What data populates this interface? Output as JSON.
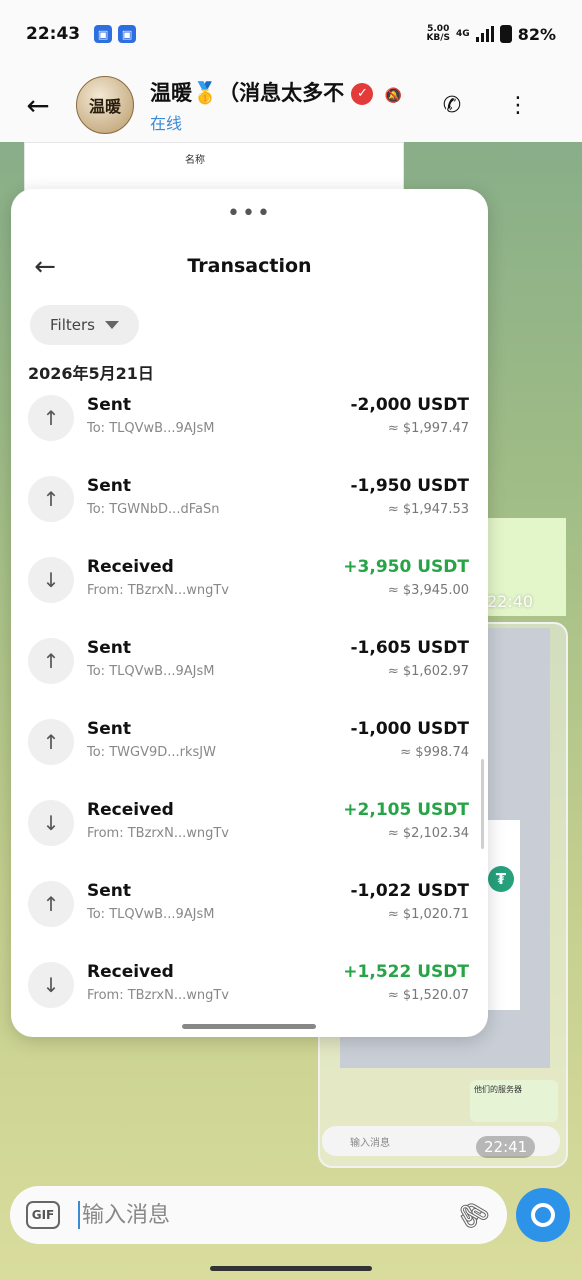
{
  "status_bar": {
    "time": "22:43",
    "net_speed_value": "5.00",
    "net_speed_unit": "KB/S",
    "network": "4G",
    "battery": "82%"
  },
  "chat_header": {
    "title": "温暖🥇（消息太多不",
    "subtitle": "在线",
    "avatar_text": "温暖"
  },
  "background": {
    "screenshot_header_cell": "名称",
    "bubble_time_1": "22:40",
    "inner_input_placeholder": "输入消息",
    "inner_time": "22:41",
    "inner_bubble_text": "他们的服务器"
  },
  "transaction_sheet": {
    "dots": "•••",
    "title": "Transaction",
    "filters_label": "Filters",
    "date": "2026年5月21日",
    "transactions": [
      {
        "type": "Sent",
        "address": "To: TLQVwB...9AJsM",
        "amount": "-2,000 USDT",
        "fiat": "≈ $1,997.47",
        "direction": "out"
      },
      {
        "type": "Sent",
        "address": "To: TGWNbD...dFaSn",
        "amount": "-1,950 USDT",
        "fiat": "≈ $1,947.53",
        "direction": "out"
      },
      {
        "type": "Received",
        "address": "From: TBzrxN...wngTv",
        "amount": "+3,950 USDT",
        "fiat": "≈ $3,945.00",
        "direction": "in"
      },
      {
        "type": "Sent",
        "address": "To: TLQVwB...9AJsM",
        "amount": "-1,605 USDT",
        "fiat": "≈ $1,602.97",
        "direction": "out"
      },
      {
        "type": "Sent",
        "address": "To: TWGV9D...rksJW",
        "amount": "-1,000 USDT",
        "fiat": "≈ $998.74",
        "direction": "out"
      },
      {
        "type": "Received",
        "address": "From: TBzrxN...wngTv",
        "amount": "+2,105 USDT",
        "fiat": "≈ $2,102.34",
        "direction": "in"
      },
      {
        "type": "Sent",
        "address": "To: TLQVwB...9AJsM",
        "amount": "-1,022 USDT",
        "fiat": "≈ $1,020.71",
        "direction": "out"
      },
      {
        "type": "Received",
        "address": "From: TBzrxN...wngTv",
        "amount": "+1,522 USDT",
        "fiat": "≈ $1,520.07",
        "direction": "in"
      }
    ]
  },
  "input_bar": {
    "gif_label": "GIF",
    "placeholder": "输入消息"
  },
  "icons": {
    "back": "arrow-left",
    "call": "phone",
    "menu": "vertical-dots",
    "mute": "bell-off",
    "verified": "verified-badge",
    "sent": "arrow-up",
    "received": "arrow-down",
    "attach": "paperclip",
    "camera": "camera"
  },
  "colors": {
    "positive_amount": "#27a447",
    "subtitle_online": "#3b8ad8",
    "camera_button": "#2d93e8",
    "verified_badge": "#e33a3a"
  }
}
